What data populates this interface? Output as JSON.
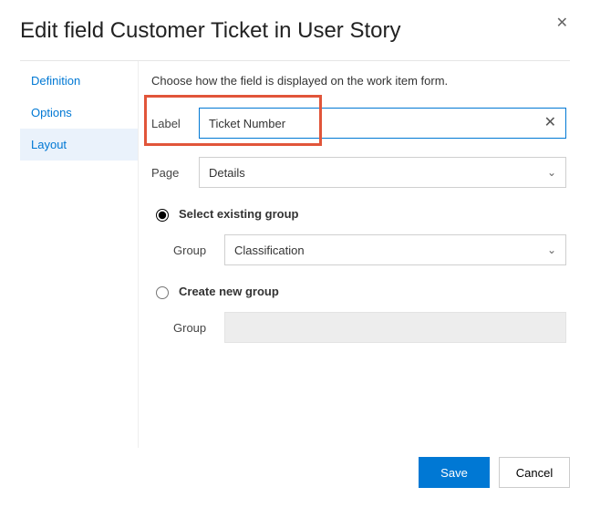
{
  "dialog": {
    "title": "Edit field Customer Ticket in User Story"
  },
  "tabs": {
    "items": [
      {
        "label": "Definition",
        "selected": false
      },
      {
        "label": "Options",
        "selected": false
      },
      {
        "label": "Layout",
        "selected": true
      }
    ]
  },
  "panel": {
    "description": "Choose how the field is displayed on the work item form.",
    "label_field": {
      "label": "Label",
      "value": "Ticket Number"
    },
    "page_field": {
      "label": "Page",
      "value": "Details"
    },
    "group_mode": {
      "existing": {
        "label": "Select existing group",
        "checked": true
      },
      "create": {
        "label": "Create new group",
        "checked": false
      }
    },
    "group_existing": {
      "label": "Group",
      "value": "Classification"
    },
    "group_new": {
      "label": "Group",
      "value": ""
    }
  },
  "footer": {
    "save": "Save",
    "cancel": "Cancel"
  }
}
